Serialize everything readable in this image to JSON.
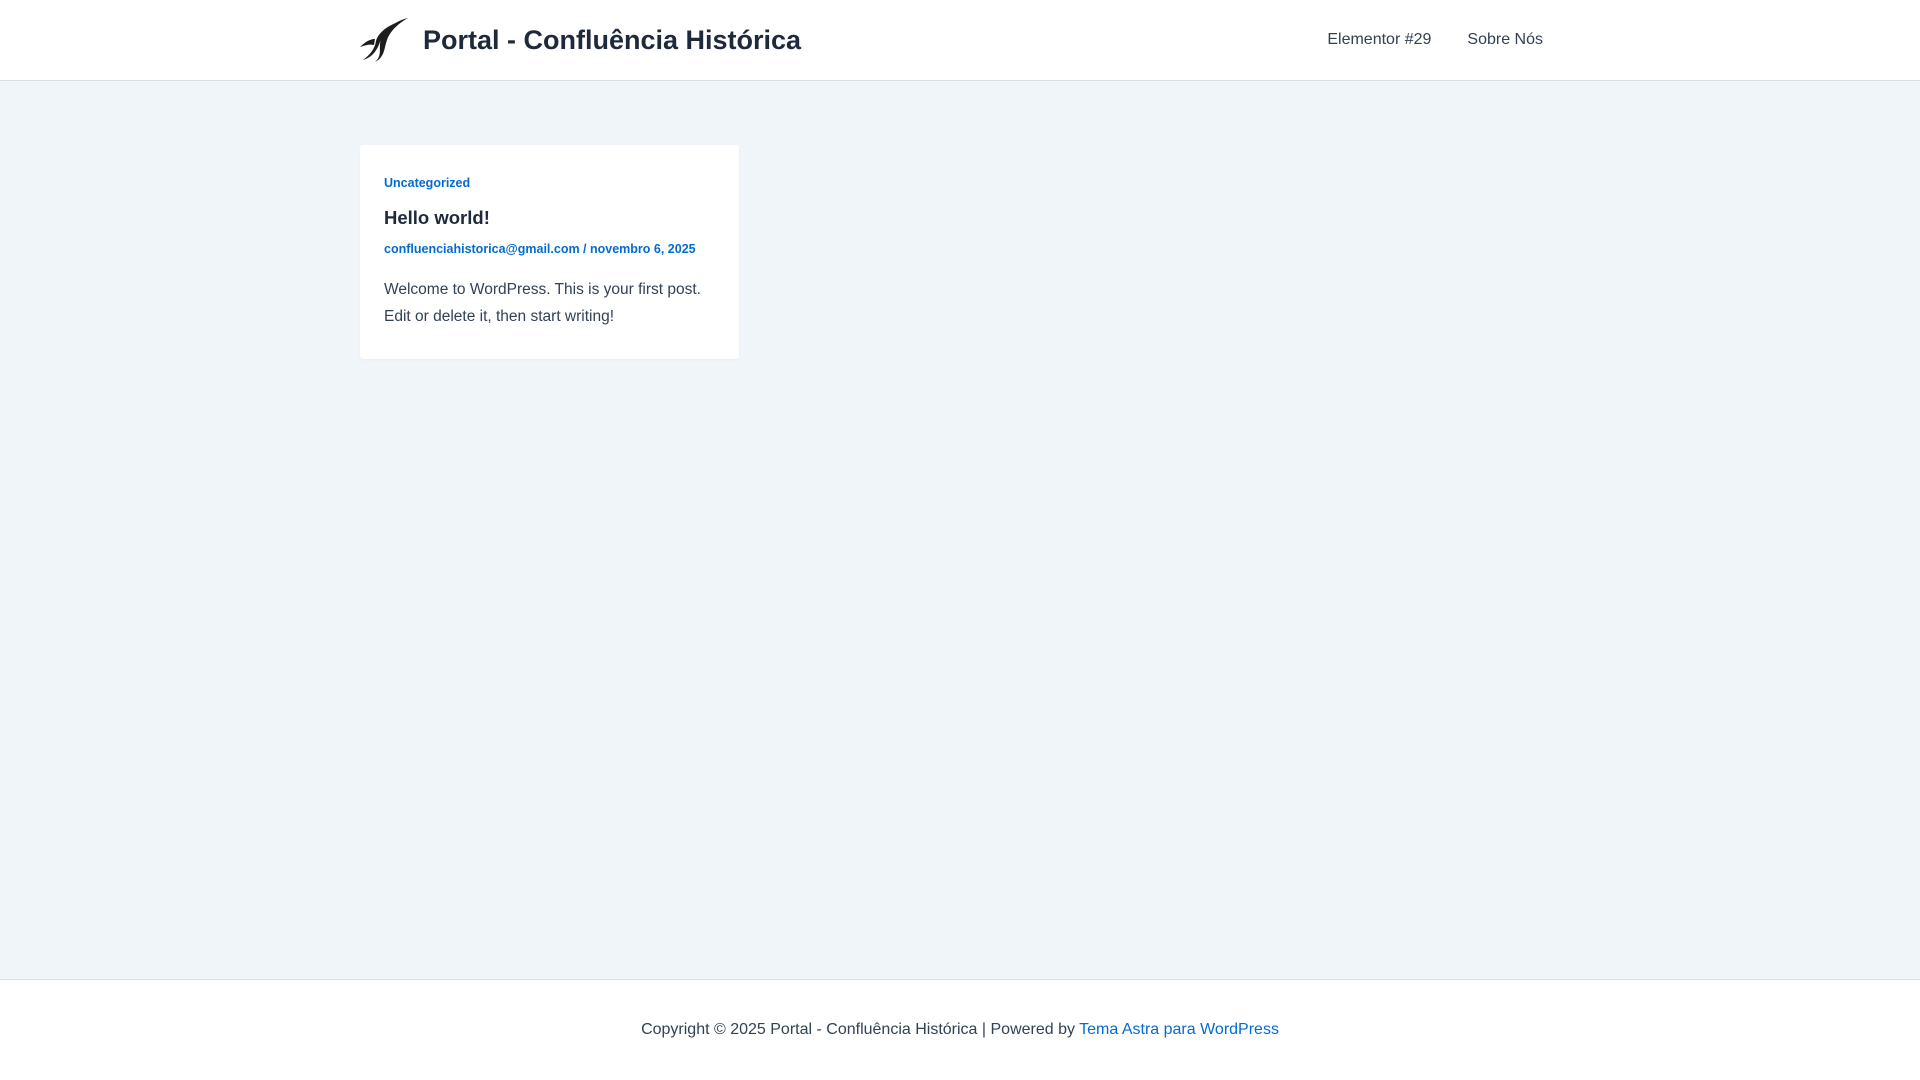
{
  "header": {
    "site_title": "Portal - Confluência Histórica",
    "logo_icon": "stylized-s-swoosh-logo",
    "nav": [
      {
        "label": "Elementor #29"
      },
      {
        "label": "Sobre Nós"
      }
    ]
  },
  "post": {
    "category": "Uncategorized",
    "title": "Hello world!",
    "author": "confluenciahistorica@gmail.com",
    "separator": " / ",
    "date": "novembro 6, 2025",
    "excerpt": "Welcome to WordPress. This is your first post. Edit or delete it, then start writing!"
  },
  "footer": {
    "copyright": "Copyright © 2025 Portal - Confluência Histórica | Powered by ",
    "theme_link": "Tema Astra para WordPress"
  },
  "colors": {
    "accent": "#046bd2",
    "heading": "#1e293b",
    "body_bg": "#f0f5fa",
    "surface": "#ffffff"
  }
}
